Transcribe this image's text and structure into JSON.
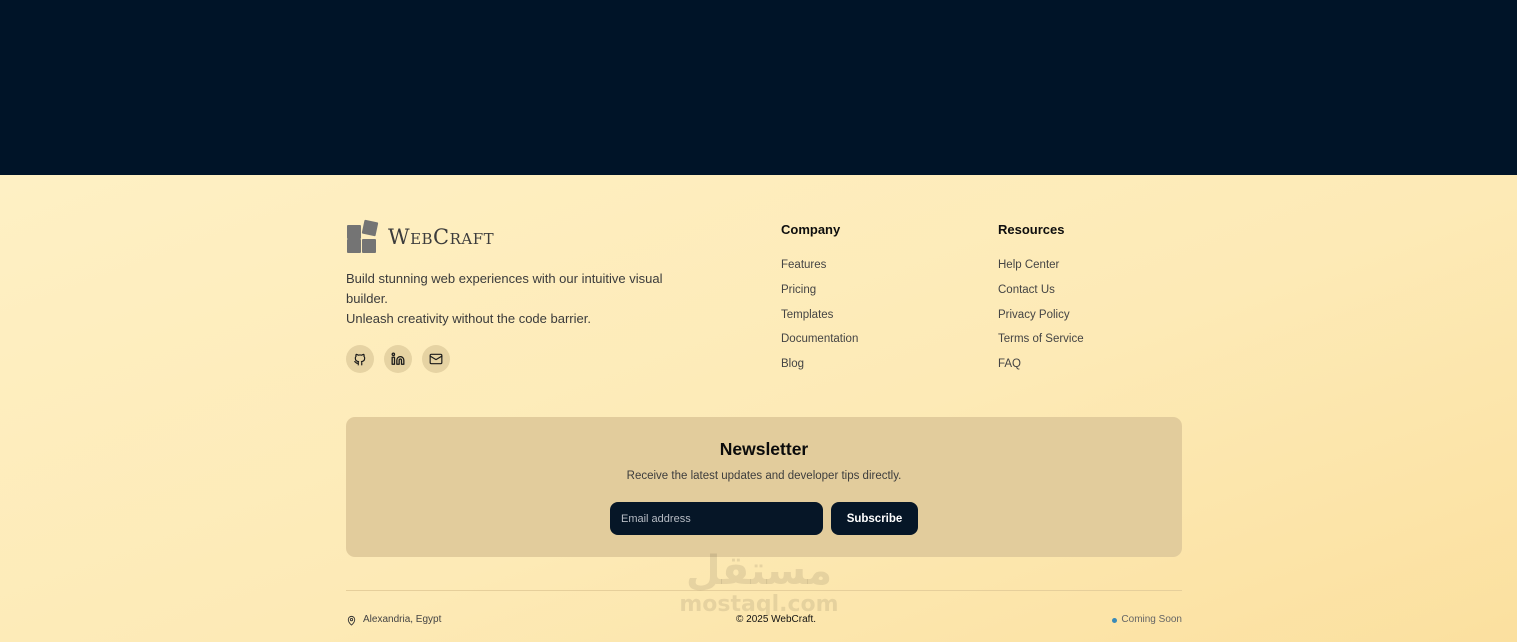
{
  "brand": {
    "name": "WebCraft",
    "tagline_line1": "Build stunning web experiences with our intuitive visual builder.",
    "tagline_line2": "Unleash creativity without the code barrier."
  },
  "socials": [
    {
      "icon": "github-icon"
    },
    {
      "icon": "linkedin-icon"
    },
    {
      "icon": "mail-icon"
    }
  ],
  "company": {
    "heading": "Company",
    "links": [
      "Features",
      "Pricing",
      "Templates",
      "Documentation",
      "Blog"
    ]
  },
  "resources": {
    "heading": "Resources",
    "links": [
      "Help Center",
      "Contact Us",
      "Privacy Policy",
      "Terms of Service",
      "FAQ"
    ]
  },
  "newsletter": {
    "title": "Newsletter",
    "description": "Receive the latest updates and developer tips directly.",
    "email_placeholder": "Email address",
    "email_value": "",
    "button_label": "Subscribe"
  },
  "bottom": {
    "location": "Alexandria, Egypt",
    "copyright": "© 2025 WebCraft.",
    "status": "Coming Soon"
  },
  "watermark": {
    "arabic": "مستقل",
    "latin": "mostaql.com"
  },
  "colors": {
    "top_band": "#001428",
    "footer_bg": "#fdecbb",
    "newsletter_bg": "#e2cc9c",
    "button_bg": "#061627",
    "status_dot": "#3a8ab8"
  }
}
